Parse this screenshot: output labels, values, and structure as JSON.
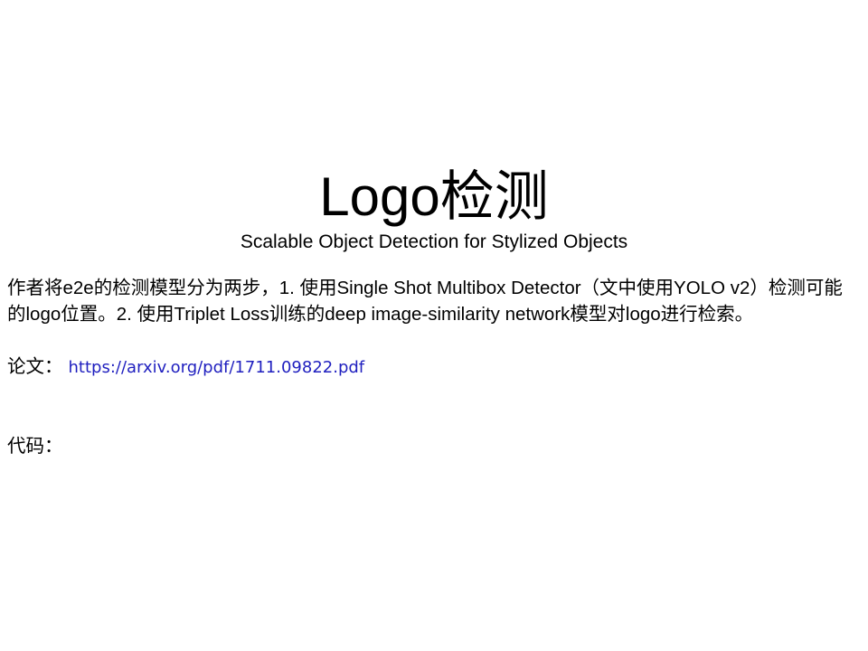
{
  "slide": {
    "title": "Logo检测",
    "subtitle": "Scalable Object Detection for Stylized Objects",
    "description": "作者将e2e的检测模型分为两步，1. 使用Single Shot Multibox Detector（文中使用YOLO v2）检测可能的logo位置。2. 使用Triplet Loss训练的deep image-similarity network模型对logo进行检索。",
    "paper_label": "论文：",
    "paper_url": "https://arxiv.org/pdf/1711.09822.pdf",
    "code_label": "代码："
  },
  "colors": {
    "background": "#ffffff",
    "text": "#000000",
    "link": "#1f1fbf"
  }
}
